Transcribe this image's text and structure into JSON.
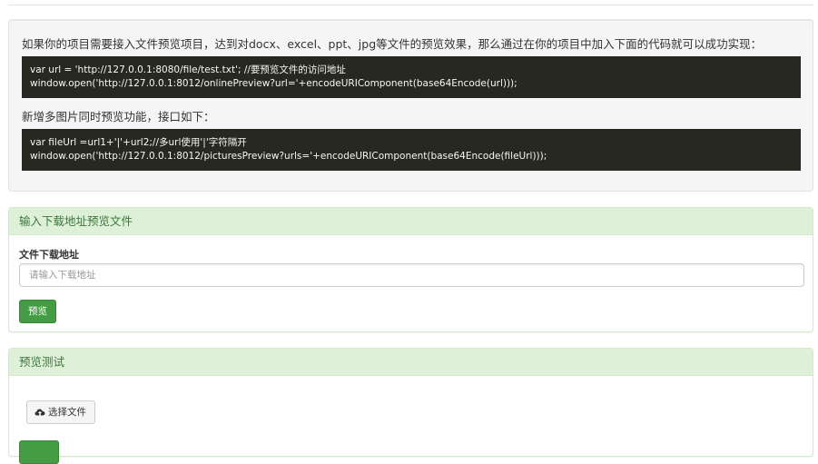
{
  "intro": {
    "text": "如果你的项目需要接入文件预览项目，达到对docx、excel、ppt、jpg等文件的预览效果，那么通过在你的项目中加入下面的代码就可以成功实现：",
    "code1": [
      "var url = 'http://127.0.0.1:8080/file/test.txt'; //要预览文件的访问地址",
      "window.open('http://127.0.0.1:8012/onlinePreview?url='+encodeURIComponent(base64Encode(url)));"
    ],
    "multi_text": "新增多图片同时预览功能，接口如下：",
    "code2": [
      "var fileUrl =url1+'|'+url2;//多url使用'|'字符隔开",
      "window.open('http://127.0.0.1:8012/picturesPreview?urls='+encodeURIComponent(base64Encode(fileUrl)));"
    ]
  },
  "download_panel": {
    "title": "输入下载地址预览文件",
    "field_label": "文件下载地址",
    "input_value": "",
    "input_placeholder": "请输入下载地址",
    "preview_button": "预览"
  },
  "test_panel": {
    "title": "预览测试",
    "choose_file_button": "选择文件",
    "choose_file_icon": "cloud-upload-icon"
  },
  "colors": {
    "panel_heading_bg": "#dff0d8",
    "panel_heading_text": "#3c763d",
    "code_bg": "#272822",
    "button_success": "#449d44"
  }
}
